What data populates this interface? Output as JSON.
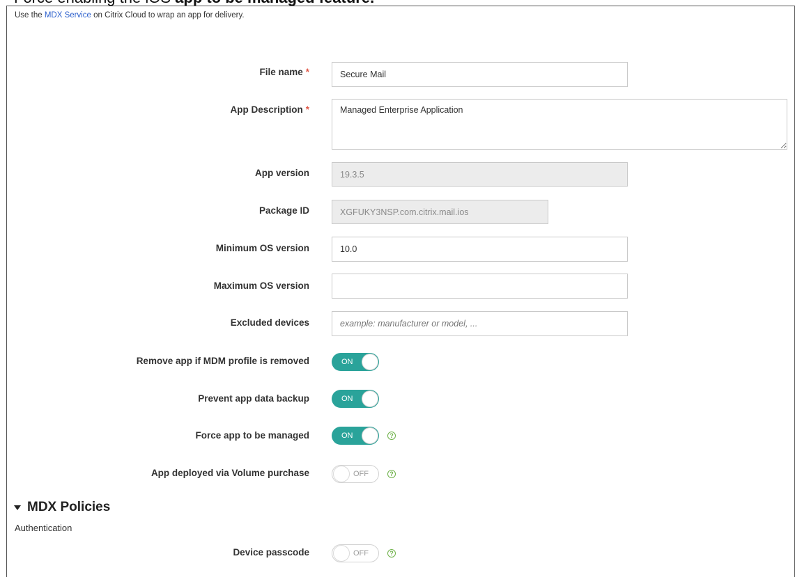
{
  "header": {
    "cut_title_prefix": "Force enabling the iOS ",
    "cut_title_bold": "app to be managed feature."
  },
  "intro": {
    "prefix": "Use the ",
    "link": "MDX Service",
    "suffix": " on Citrix Cloud to wrap an app for delivery."
  },
  "form": {
    "file_name": {
      "label": "File name",
      "required_mark": "*",
      "value": "Secure Mail"
    },
    "app_description": {
      "label": "App Description",
      "required_mark": "*",
      "value": "Managed Enterprise Application"
    },
    "app_version": {
      "label": "App version",
      "value": "19.3.5"
    },
    "package_id": {
      "label": "Package ID",
      "value": "XGFUKY3NSP.com.citrix.mail.ios"
    },
    "min_os": {
      "label": "Minimum OS version",
      "value": "10.0"
    },
    "max_os": {
      "label": "Maximum OS version",
      "value": ""
    },
    "excluded_devices": {
      "label": "Excluded devices",
      "value": "",
      "placeholder": "example: manufacturer or model, ..."
    },
    "remove_app": {
      "label": "Remove app if MDM profile is removed",
      "state": "ON"
    },
    "prevent_backup": {
      "label": "Prevent app data backup",
      "state": "ON"
    },
    "force_managed": {
      "label": "Force app to be managed",
      "state": "ON"
    },
    "volume_purchase": {
      "label": "App deployed via Volume purchase",
      "state": "OFF"
    }
  },
  "mdx": {
    "title": "MDX Policies",
    "subsection": "Authentication",
    "device_passcode": {
      "label": "Device passcode",
      "state": "OFF"
    }
  },
  "help_glyph": "?",
  "colors": {
    "toggle_on": "#2aa39a",
    "link": "#2b5fcc",
    "required": "#e05a4a",
    "help": "#6fb24a"
  }
}
